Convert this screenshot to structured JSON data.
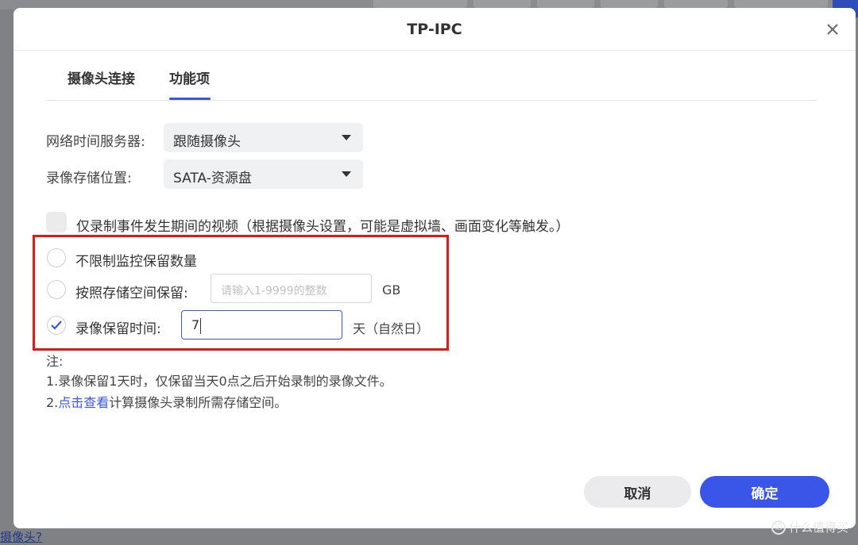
{
  "background": {
    "bottom_link": "摄像头?"
  },
  "watermark": {
    "text": "值 什么值得买",
    "icon": "zhi-logo-icon"
  },
  "dialog": {
    "title": "TP-IPC",
    "close_icon": "close-icon"
  },
  "tabs": [
    {
      "label": "摄像头连接",
      "active": false
    },
    {
      "label": "功能项",
      "active": true
    }
  ],
  "form": {
    "ntp_label": "网络时间服务器:",
    "ntp_value": "跟随摄像头",
    "storage_label": "录像存储位置:",
    "storage_value": "SATA-资源盘",
    "event_only_label": "仅录制事件发生期间的视频（根据摄像头设置，可能是虚拟墙、画面变化等触发。）",
    "event_only_checked": false,
    "retention_options": [
      {
        "label": "不限制监控保留数量",
        "selected": false
      },
      {
        "label": "按照存储空间保留:",
        "selected": false,
        "placeholder": "请输入1-9999的整数",
        "unit": "GB"
      },
      {
        "label": "录像保留时间:",
        "selected": true,
        "value": "7",
        "unit": "天（自然日）"
      }
    ]
  },
  "notes": {
    "heading": "注:",
    "line1": "1.录像保留1天时，仅保留当天0点之后开始录制的录像文件。",
    "line2_prefix": "2.",
    "line2_link": "点击查看",
    "line2_suffix": "计算摄像头录制所需存储空间。"
  },
  "buttons": {
    "cancel": "取消",
    "ok": "确定"
  },
  "colors": {
    "accent": "#3a56e8",
    "highlight_frame": "#e01818"
  }
}
